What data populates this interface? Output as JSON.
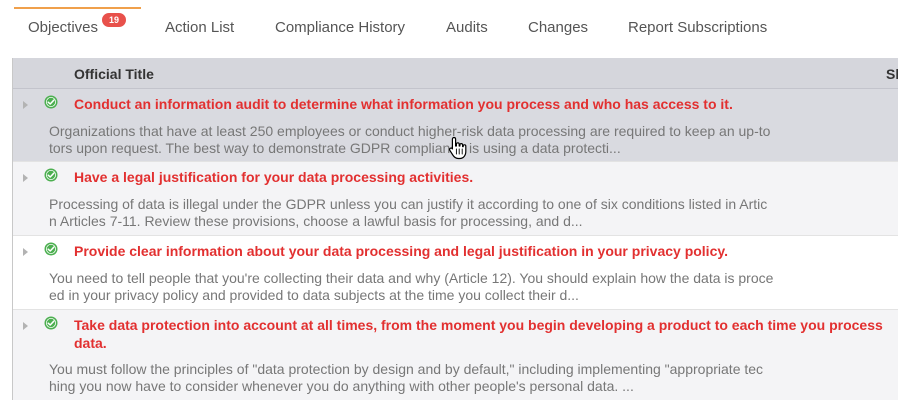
{
  "tabs": [
    {
      "label": "Objectives",
      "badge": "19",
      "active": true
    },
    {
      "label": "Action List"
    },
    {
      "label": "Compliance History"
    },
    {
      "label": "Audits"
    },
    {
      "label": "Changes"
    },
    {
      "label": "Report Subscriptions"
    }
  ],
  "table": {
    "columns": [
      "Official Title",
      "Sh"
    ],
    "rows": [
      {
        "title": "Conduct an information audit to determine what information you process and who has access to it.",
        "desc_line1": "Organizations that have at least 250 employees or conduct higher-risk data processing are required to keep an up-to",
        "desc_line2": "tors upon request. The best way to demonstrate GDPR compliance is using a data protecti...",
        "status_icon": "check-circle-icon"
      },
      {
        "title": "Have a legal justification for your data processing activities.",
        "desc_line1": "Processing of data is illegal under the GDPR unless you can justify it according to one of six conditions listed in Artic",
        "desc_line2": "n Articles 7-11. Review these provisions, choose a lawful basis for processing, and d...",
        "status_icon": "check-circle-icon"
      },
      {
        "title": "Provide clear information about your data processing and legal justification in your privacy policy.",
        "desc_line1": "You need to tell people that you're collecting their data and why (Article 12). You should explain how the data is proce",
        "desc_line2": "ed in your privacy policy and provided to data subjects at the time you collect their d...",
        "status_icon": "check-circle-icon"
      },
      {
        "title": "Take data protection into account at all times, from the moment you begin developing a product to each time you process data.",
        "desc_line1": "You must follow the principles of \"data protection by design and by default,\" including implementing \"appropriate tec",
        "desc_line2": "hing you now have to consider whenever you do anything with other people's personal data. ...",
        "status_icon": "check-circle-icon"
      }
    ]
  },
  "colors": {
    "accent_underline": "#f0a04b",
    "badge": "#e8514b",
    "title_red": "#e23030",
    "check_green": "#4caf50",
    "header_bg": "#d5d6dc"
  }
}
